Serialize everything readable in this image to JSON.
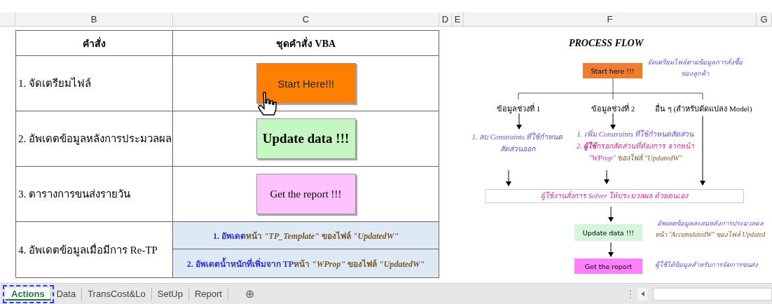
{
  "columns": [
    {
      "label": "B"
    },
    {
      "label": "C"
    },
    {
      "label": "D"
    },
    {
      "label": "E"
    },
    {
      "label": "F"
    },
    {
      "label": "G"
    }
  ],
  "table": {
    "headers": [
      "คำสั่ง",
      "ชุดคำสั่ง VBA"
    ],
    "rows": [
      {
        "label": "1. จัดเตรียมไฟล์",
        "action": {
          "kind": "button",
          "text": "Start Here!!!",
          "color": "#ff8000"
        }
      },
      {
        "label": "2. อัพเดตข้อมูลหลังการประมวลผล",
        "action": {
          "kind": "button",
          "text": "Update data !!!",
          "color": "#c6f7c3"
        }
      },
      {
        "label": "3. ตารางการขนส่งรายวัน",
        "action": {
          "kind": "button",
          "text": "Get the report !!!",
          "color": "#ffc1ff"
        }
      },
      {
        "label": "4. อัพเดตข้อมูลเมื่อมีการ Re-TP",
        "action": {
          "kind": "links",
          "items": [
            [
              {
                "kind": "term",
                "text": "1. อัพเดต"
              },
              {
                "kind": "note",
                "text": "หน้า *\"TP_Template\"* ของไฟล์ *\"UpdatedW\"*"
              }
            ],
            [
              {
                "kind": "term",
                "text": "2. อัพเดตน้ำหนักที่เพิ่มจาก TP"
              },
              {
                "kind": "note",
                "text": " หน้า *\"WProp\"*  ของไฟล์ *\"UpdatedW\"*"
              }
            ]
          ]
        }
      }
    ]
  },
  "flow": {
    "title": "PROCESS FLOW",
    "start": {
      "text": "Start here !!!",
      "note": "จัดเตรียมไฟล์ตามข้อมูลการสั่งซื้อของลูกค้า"
    },
    "branches": [
      "ข้อมูลช่วงที่ 1",
      "ข้อมูลช่วงที่ 2",
      "อื่น ๆ (สำหรับดัดแปลง Model)"
    ],
    "branch_notes": [
      [
        [
          {
            "kind": "hint",
            "text": "1. ลบ Constraints ที่ใช้กำหนดสัดส่วนออก"
          }
        ]
      ],
      [
        [
          {
            "kind": "hint",
            "text": "1. เพิ่ม Constraints ที่ใช้กำหนดสัดส่วน"
          }
        ],
        [
          {
            "kind": "alert",
            "text": "2. **ผู้ใช้**กรอกสัดส่วนที่ต้องการ จากหน้า \"WProp\""
          },
          {
            "kind": "note",
            "text": " ของไฟล์ \"UpdatedW\""
          }
        ]
      ]
    ],
    "solver": "ผู้ใช้งานสั่งการ Solver  ให้ประมวลผล ด้วยตนเอง",
    "update": {
      "text": "Update data !!!",
      "note": [
        [
          {
            "kind": "hint",
            "text": "อัพเดตข้อมูลสะสมหลังการประมวลผล"
          }
        ],
        [
          {
            "kind": "note",
            "text": "หน้า \"AccumulatedW\" ของไฟล์ Updated"
          }
        ]
      ]
    },
    "report": {
      "text": "Get the report",
      "note": [
        [
          {
            "kind": "hint",
            "text": "ผู้ใช้ได้ข้อมูลสำหรับการจัดการขนส่ง"
          }
        ]
      ]
    }
  },
  "sheet_tabs": [
    {
      "label": "Actions",
      "selected": true
    },
    {
      "label": "Data",
      "selected": false
    },
    {
      "label": "TransCost&Lo",
      "selected": false
    },
    {
      "label": "SetUp",
      "selected": false
    },
    {
      "label": "Report",
      "selected": false
    }
  ],
  "add_sheet": "⊕"
}
